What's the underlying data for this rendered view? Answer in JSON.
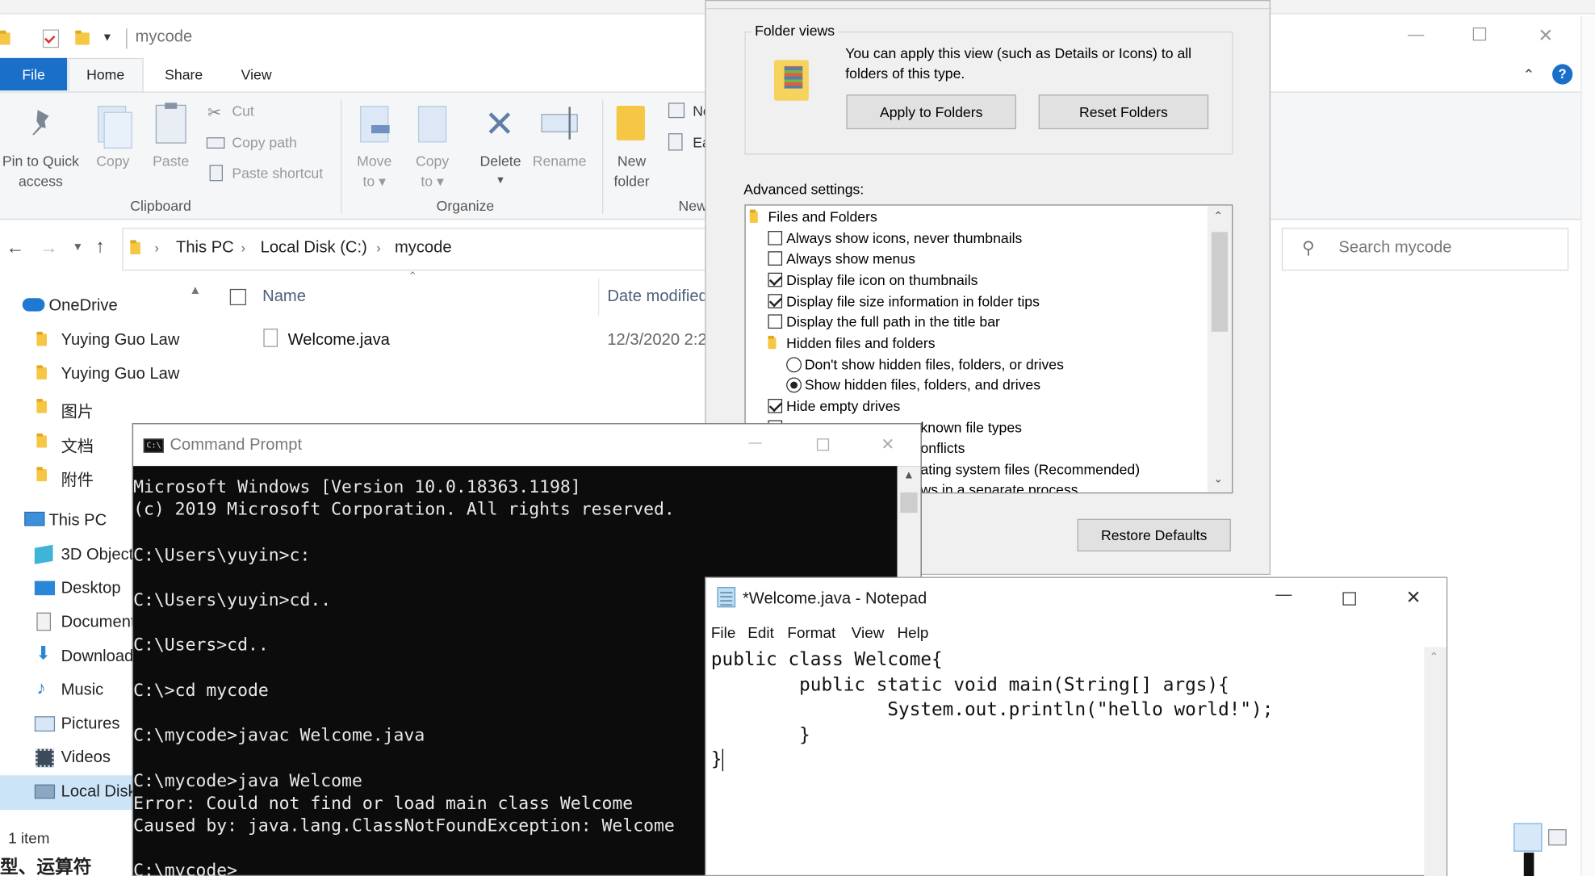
{
  "explorer": {
    "title": "mycode",
    "tabs": {
      "file": "File",
      "home": "Home",
      "share": "Share",
      "view": "View"
    },
    "ribbon": {
      "pin_label_1": "Pin to Quick",
      "pin_label_2": "access",
      "copy": "Copy",
      "paste": "Paste",
      "cut": "Cut",
      "copy_path": "Copy path",
      "paste_shortcut": "Paste shortcut",
      "clipboard": "Clipboard",
      "move_1": "Move",
      "move_2": "to",
      "copyto_1": "Copy",
      "copyto_2": "to",
      "delete": "Delete",
      "rename": "Rename",
      "organize": "Organize",
      "newfolder_1": "New",
      "newfolder_2": "folder",
      "new_item_cut": "Ne",
      "easy_access_cut": "Ea",
      "new_group_cut": "New"
    },
    "breadcrumb": [
      "This PC",
      "Local Disk (C:)",
      "mycode"
    ],
    "search_placeholder": "Search mycode",
    "nav": [
      "OneDrive",
      "Yuying Guo Law",
      "Yuying Guo Law",
      "图片",
      "文档",
      "附件",
      "This PC",
      "3D Objects",
      "Desktop",
      "Documents",
      "Downloads",
      "Music",
      "Pictures",
      "Videos",
      "Local Disk"
    ],
    "columns": {
      "name": "Name",
      "date": "Date modified"
    },
    "files": [
      {
        "name": "Welcome.java",
        "date": "12/3/2020 2:2"
      }
    ],
    "status": "1 item",
    "bottom_text": "型、运算符"
  },
  "folder_options": {
    "folder_views_title": "Folder views",
    "folder_views_text_1": "You can apply this view (such as Details or Icons) to all",
    "folder_views_text_2": "folders of this type.",
    "apply_button": "Apply to Folders",
    "reset_button": "Reset Folders",
    "advanced_label": "Advanced settings:",
    "tree": [
      {
        "kind": "folder",
        "label": "Files and Folders"
      },
      {
        "kind": "check",
        "checked": false,
        "label": "Always show icons, never thumbnails"
      },
      {
        "kind": "check",
        "checked": false,
        "label": "Always show menus"
      },
      {
        "kind": "check",
        "checked": true,
        "label": "Display file icon on thumbnails"
      },
      {
        "kind": "check",
        "checked": true,
        "label": "Display file size information in folder tips"
      },
      {
        "kind": "check",
        "checked": false,
        "label": "Display the full path in the title bar"
      },
      {
        "kind": "folder",
        "label": "Hidden files and folders"
      },
      {
        "kind": "radio",
        "checked": false,
        "label": "Don't show hidden files, folders, or drives"
      },
      {
        "kind": "radio",
        "checked": true,
        "label": "Show hidden files, folders, and drives"
      },
      {
        "kind": "check",
        "checked": true,
        "label": "Hide empty drives"
      },
      {
        "kind": "check",
        "checked": false,
        "label": "known file types"
      },
      {
        "kind": "check",
        "checked": false,
        "label": "onflicts"
      },
      {
        "kind": "check",
        "checked": false,
        "label": "ating system files (Recommended)"
      },
      {
        "kind": "check",
        "checked": false,
        "label": "ws in a separate process"
      }
    ],
    "restore_button": "Restore Defaults"
  },
  "cmd": {
    "title": "Command Prompt",
    "lines": [
      "Microsoft Windows [Version 10.0.18363.1198]",
      "(c) 2019 Microsoft Corporation. All rights reserved.",
      "",
      "C:\\Users\\yuyin>c:",
      "",
      "C:\\Users\\yuyin>cd..",
      "",
      "C:\\Users>cd..",
      "",
      "C:\\>cd mycode",
      "",
      "C:\\mycode>javac Welcome.java",
      "",
      "C:\\mycode>java Welcome",
      "Error: Could not find or load main class Welcome",
      "Caused by: java.lang.ClassNotFoundException: Welcome",
      "",
      "C:\\mycode>"
    ]
  },
  "notepad": {
    "title": "*Welcome.java - Notepad",
    "menu": [
      "File",
      "Edit",
      "Format",
      "View",
      "Help"
    ],
    "lines": [
      "public class Welcome{",
      "        public static void main(String[] args){",
      "                System.out.println(\"hello world!\");",
      "        }",
      "}"
    ]
  },
  "colors": {
    "accent": "#1a6fc9",
    "selection": "#cce4f7",
    "console_bg": "#0c0c0c"
  }
}
